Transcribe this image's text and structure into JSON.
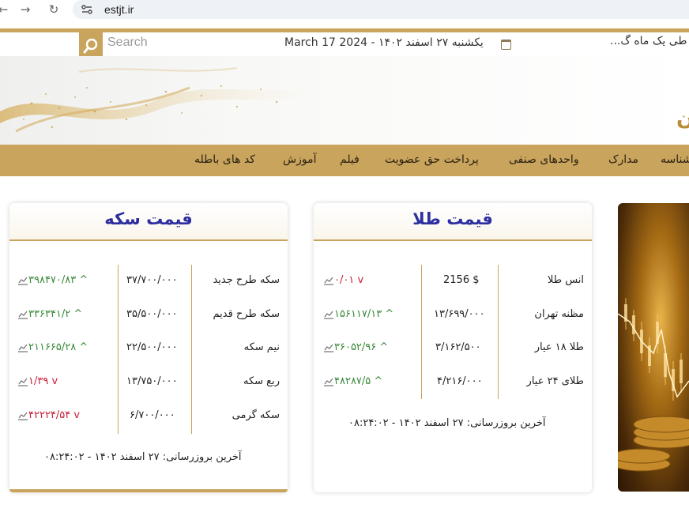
{
  "browser": {
    "url": "estjt.ir"
  },
  "header": {
    "search_placeholder": "Search",
    "date": "یکشنبه ۲۷ اسفند ۱۴۰۲ - March 17 2024",
    "news_ticker": "طی یک ماه گ..."
  },
  "banner": {
    "logo_fragment": "ن"
  },
  "menu": {
    "items": [
      "کد های باطله",
      "آموزش",
      "فیلم",
      "پرداخت حق عضویت",
      "واحدهای صنفی",
      "مدارک",
      "شناسه"
    ]
  },
  "gold_card": {
    "title": "قیمت طلا",
    "rows": [
      {
        "name": "انس طلا",
        "price": "2156 $",
        "change": "۰/۰۱",
        "direction": "down"
      },
      {
        "name": "مظنه تهران",
        "price": "۱۳/۶۹۹/۰۰۰",
        "change": "۱۵۶۱۱۷/۱۳",
        "direction": "up"
      },
      {
        "name": "طلا ۱۸ عیار",
        "price": "۳/۱۶۲/۵۰۰",
        "change": "۳۶۰۵۲/۹۶",
        "direction": "up"
      },
      {
        "name": "طلای ۲۴ عیار",
        "price": "۴/۲۱۶/۰۰۰",
        "change": "۴۸۲۸۷/۵",
        "direction": "up"
      }
    ],
    "footer": "آخرین بروزرسانی: ۲۷ اسفند ۱۴۰۲ - ۰۸:۲۴:۰۲"
  },
  "coin_card": {
    "title": "قیمت سکه",
    "rows": [
      {
        "name": "سکه طرح جدید",
        "price": "۳۷/۷۰۰/۰۰۰",
        "change": "۳۹۸۴۷۰/۸۳",
        "direction": "up"
      },
      {
        "name": "سکه طرح قدیم",
        "price": "۳۵/۵۰۰/۰۰۰",
        "change": "۳۳۶۳۴۱/۲",
        "direction": "up"
      },
      {
        "name": "نیم سکه",
        "price": "۲۲/۵۰۰/۰۰۰",
        "change": "۲۱۱۶۶۵/۲۸",
        "direction": "up"
      },
      {
        "name": "ربع سکه",
        "price": "۱۳/۷۵۰/۰۰۰",
        "change": "۱/۳۹",
        "direction": "down"
      },
      {
        "name": "سکه گرمی",
        "price": "۶/۷۰۰/۰۰۰",
        "change": "۴۲۲۲۴/۵۴",
        "direction": "down"
      }
    ],
    "footer": "آخرین بروزرسانی: ۲۷ اسفند ۱۴۰۲ - ۰۸:۲۴:۰۲"
  },
  "colors": {
    "gold": "#c9a45c",
    "title_blue": "#2d2fa0",
    "up_green": "#3a8a3a",
    "down_red": "#c8203a"
  }
}
